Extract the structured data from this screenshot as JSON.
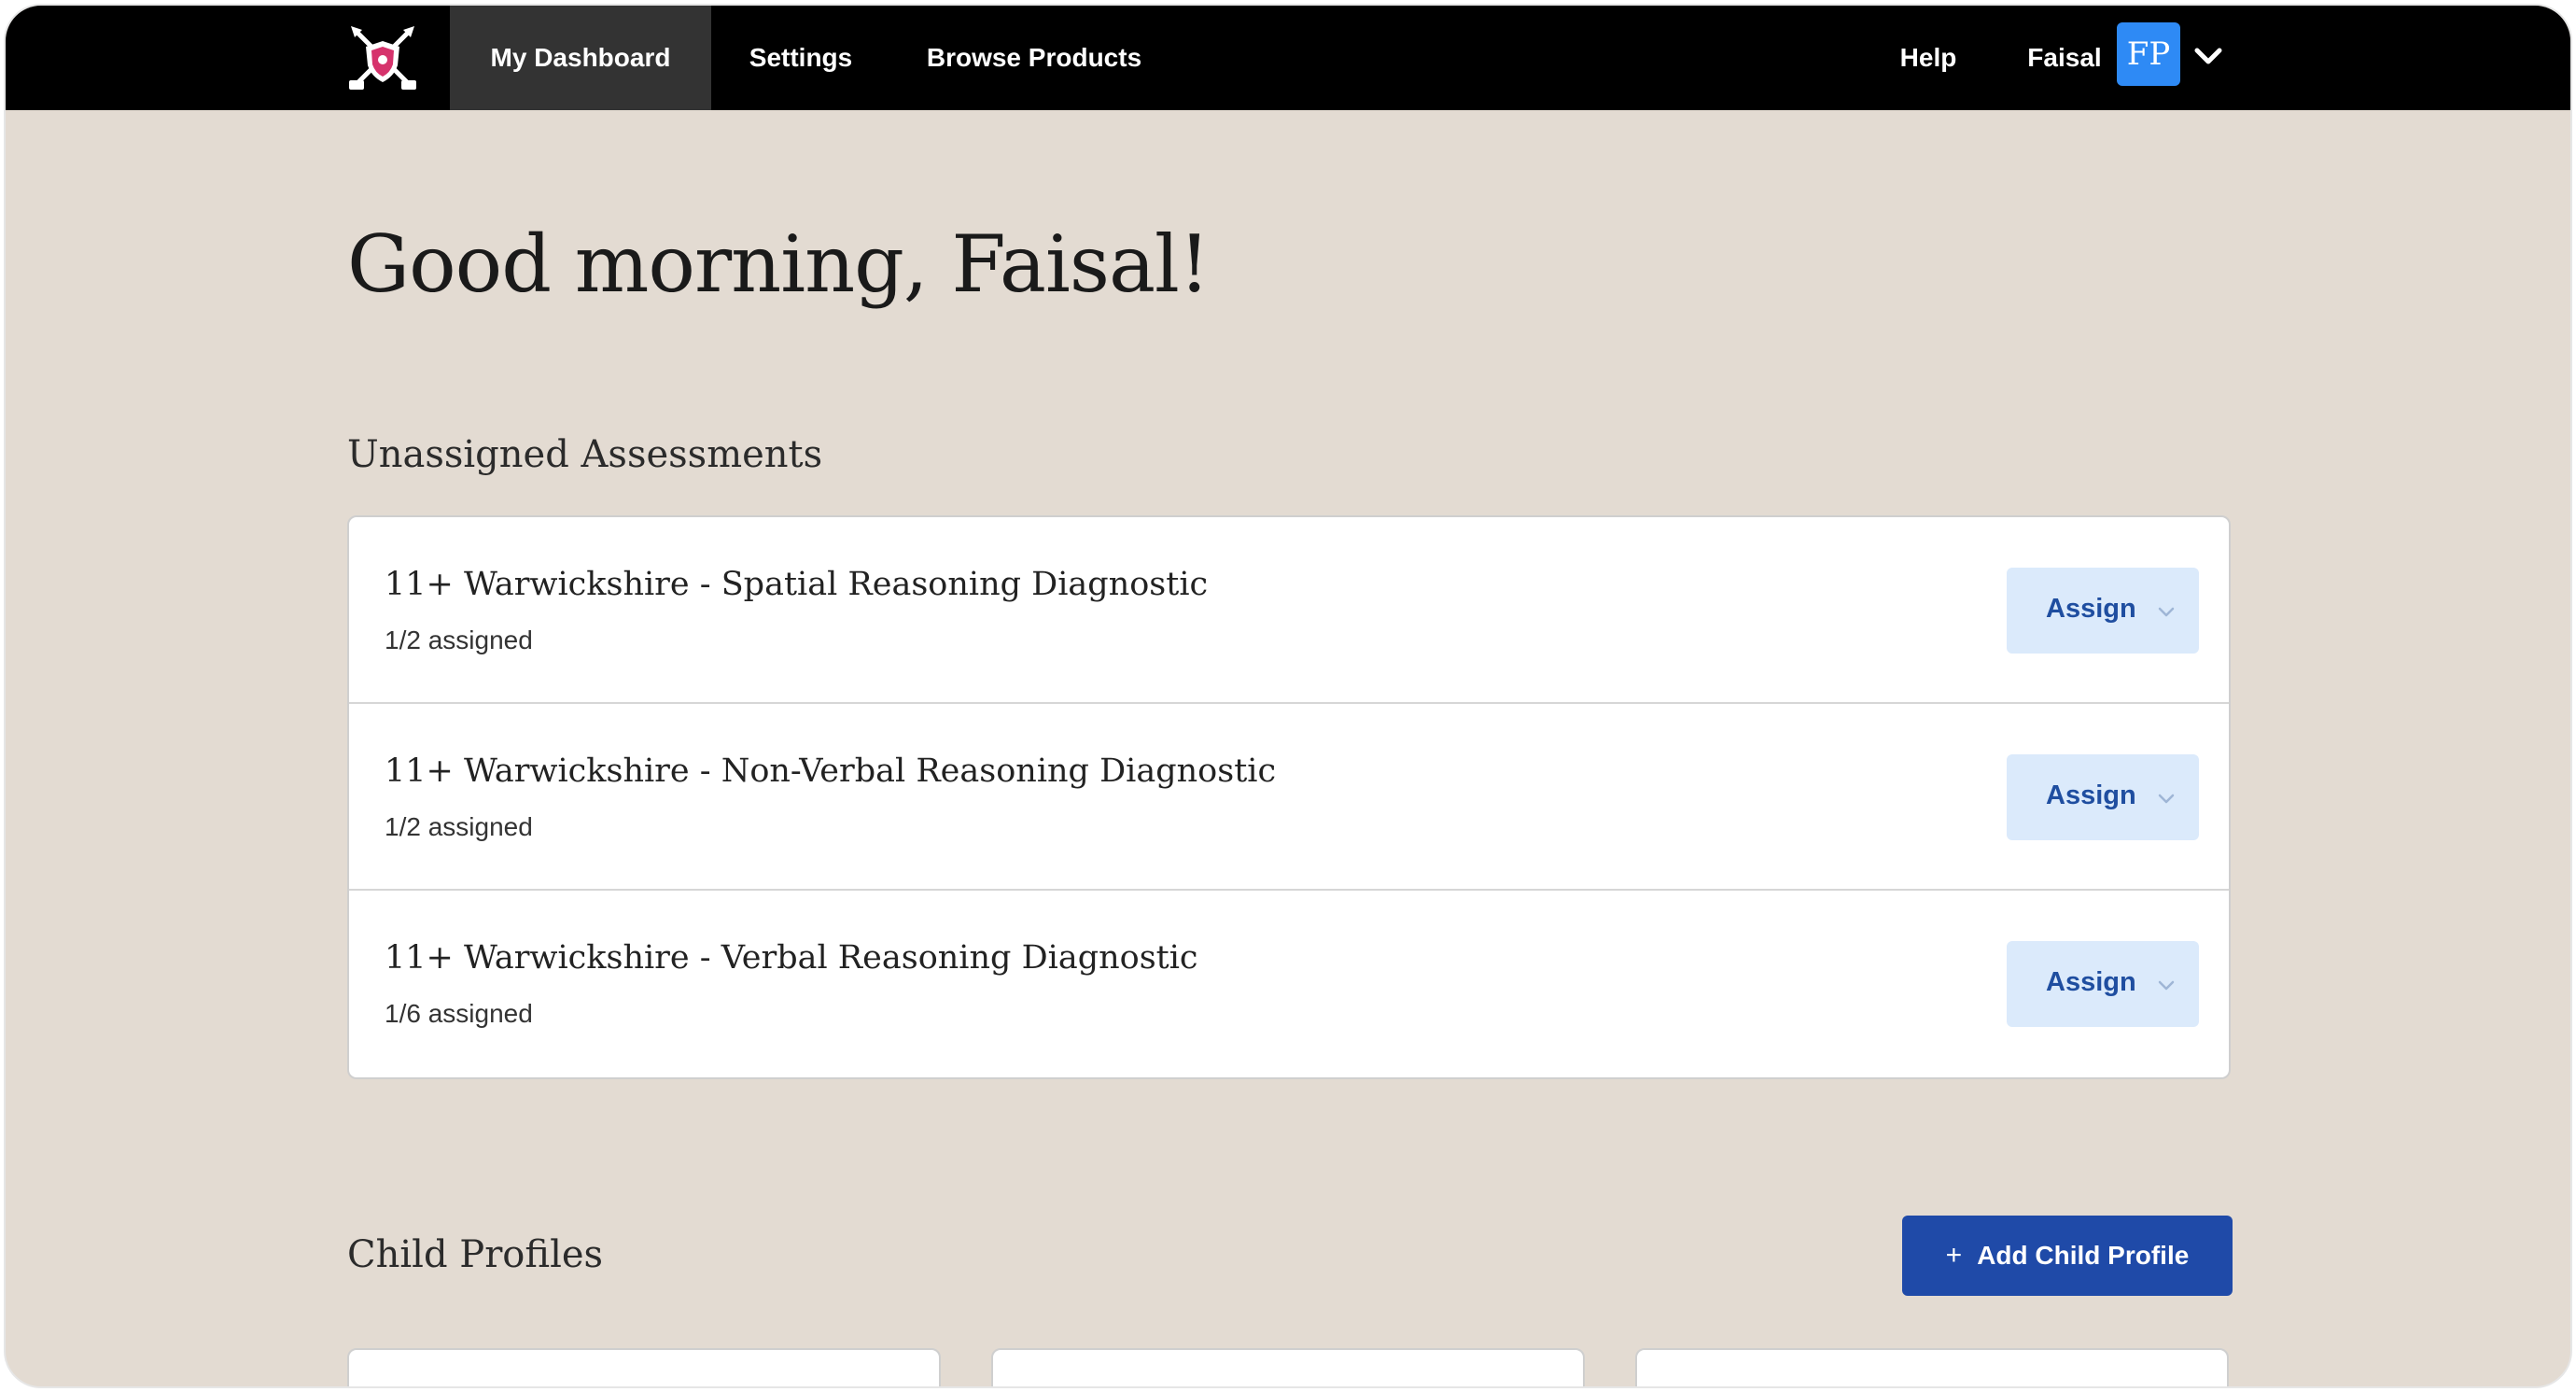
{
  "nav": {
    "items": [
      {
        "label": "My Dashboard",
        "active": true
      },
      {
        "label": "Settings",
        "active": false
      },
      {
        "label": "Browse Products",
        "active": false
      }
    ],
    "help_label": "Help",
    "user_name": "Faisal",
    "avatar_initials": "FP",
    "avatar_color": "#2e8af5",
    "logo_icon": "crossed-pencils-shield-logo"
  },
  "greeting": "Good morning, Faisal!",
  "unassigned": {
    "title": "Unassigned Assessments",
    "items": [
      {
        "name": "11+ Warwickshire - Spatial Reasoning Diagnostic",
        "assigned": "1/2 assigned",
        "button": "Assign"
      },
      {
        "name": "11+ Warwickshire - Non-Verbal Reasoning Diagnostic",
        "assigned": "1/2 assigned",
        "button": "Assign"
      },
      {
        "name": "11+ Warwickshire - Verbal Reasoning Diagnostic",
        "assigned": "1/6 assigned",
        "button": "Assign"
      }
    ]
  },
  "children": {
    "title": "Child Profiles",
    "add_label": "Add Child Profile"
  },
  "colors": {
    "background": "#e3dbd2",
    "nav": "#000000",
    "primary_button": "#1f4aa8",
    "assign_button": "#dbeafb",
    "assign_text": "#1f4ea0"
  }
}
